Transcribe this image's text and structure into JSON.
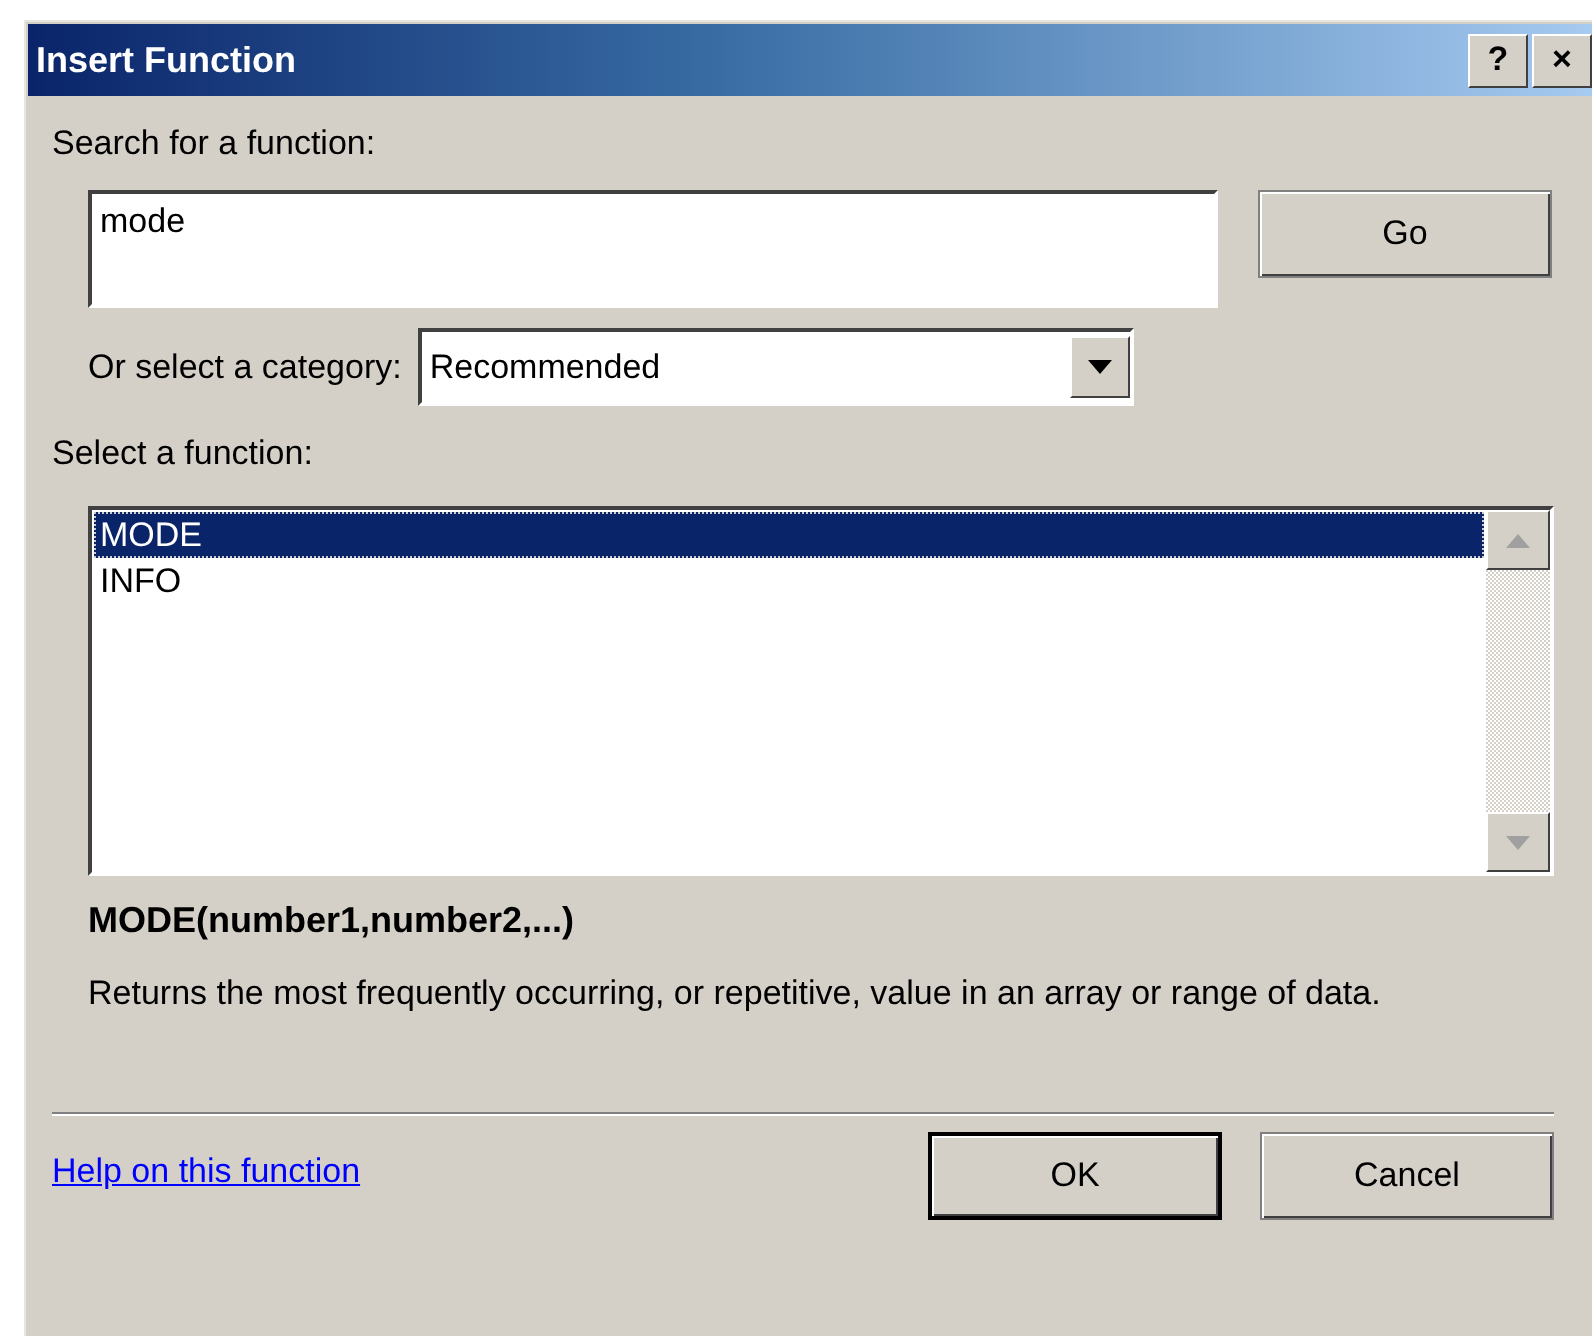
{
  "window": {
    "title": "Insert Function",
    "title_buttons": [
      "?",
      "×"
    ]
  },
  "search": {
    "label": "Search for a function:",
    "value": "mode",
    "button": "Go"
  },
  "category": {
    "label": "Or select a category:",
    "value": "Recommended"
  },
  "functions": {
    "label": "Select a function:",
    "items": [
      {
        "name": "MODE",
        "selected": true
      },
      {
        "name": "INFO",
        "selected": false
      }
    ]
  },
  "signature": "MODE(number1,number2,...)",
  "description": "Returns the most frequently occurring, or repetitive, value in an array or range of data.",
  "help_link": "Help on this function",
  "buttons": [
    {
      "label": "OK",
      "default": true
    },
    {
      "label": "Cancel",
      "default": false
    }
  ]
}
